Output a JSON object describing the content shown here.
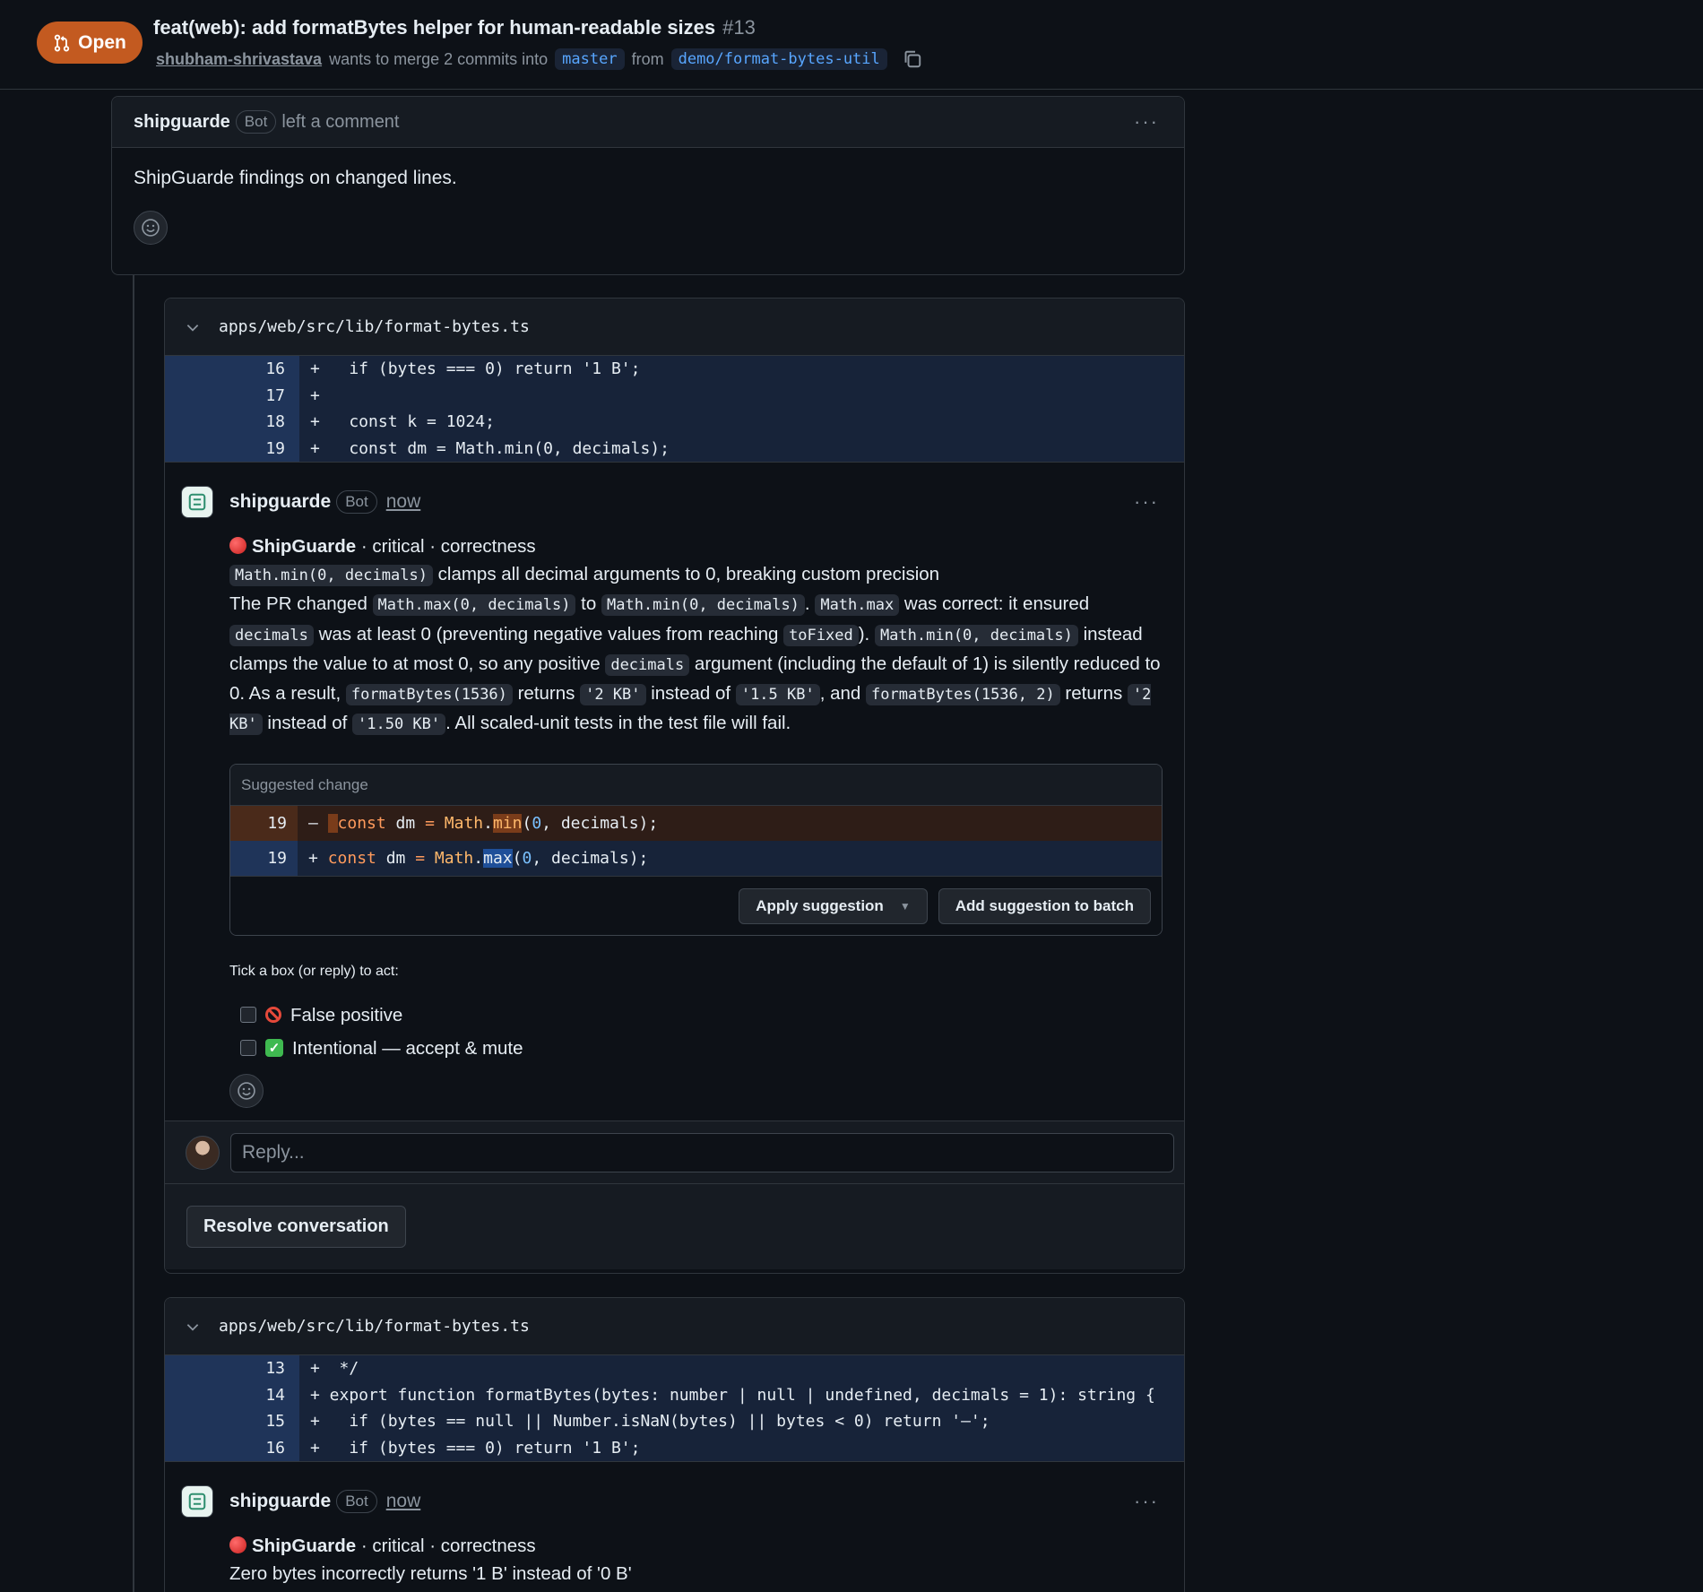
{
  "header": {
    "status": "Open",
    "title": "feat(web): add formatBytes helper for human-readable sizes",
    "number": "#13",
    "author": "shubham-shrivastava",
    "merge_text": "wants to merge 2 commits into",
    "base_branch": "master",
    "from_text": "from",
    "head_branch": "demo/format-bytes-util"
  },
  "top_comment": {
    "author": "shipguarde",
    "badge": "Bot",
    "action": "left a comment",
    "body": "ShipGuarde findings on changed lines."
  },
  "thread1": {
    "file": "apps/web/src/lib/format-bytes.ts",
    "diff": [
      {
        "line": "16",
        "code": "+   if (bytes === 0) return '1 B';"
      },
      {
        "line": "17",
        "code": "+"
      },
      {
        "line": "18",
        "code": "+   const k = 1024;"
      },
      {
        "line": "19",
        "code": "+   const dm = Math.min(0, decimals);"
      }
    ],
    "comment": {
      "author": "shipguarde",
      "badge": "Bot",
      "time": "now",
      "title_brand": "ShipGuarde",
      "title_rest": " · critical · correctness",
      "summary_code": "Math.min(0, decimals)",
      "summary_text": " clamps all decimal arguments to 0, breaking custom precision",
      "p1": "The PR changed ",
      "c1": "Math.max(0, decimals)",
      "p2": " to ",
      "c2": "Math.min(0, decimals)",
      "p3": ". ",
      "c3": "Math.max",
      "p4": " was correct: it ensured ",
      "c4": "decimals",
      "p5": " was at least 0 (preventing negative values from reaching ",
      "c5": "toFixed",
      "p6": "). ",
      "c6": "Math.min(0, decimals)",
      "p7": " instead clamps the value to at most 0, so any positive ",
      "c7": "decimals",
      "p8": " argument (including the default of 1) is silently reduced to 0. As a result, ",
      "c8": "formatBytes(1536)",
      "p9": " returns ",
      "c9": "'2 KB'",
      "p10": " instead of ",
      "c10": "'1.5 KB'",
      "p11": ", and ",
      "c11": "formatBytes(1536, 2)",
      "p12": " returns ",
      "c12": "'2 KB'",
      "p13": " instead of ",
      "c13": "'1.50 KB'",
      "p14": ". All scaled-unit tests in the test file will fail.",
      "suggestion": {
        "label": "Suggested change",
        "del_line": "19",
        "add_line": "19",
        "apply_label": "Apply suggestion",
        "batch_label": "Add suggestion to batch"
      },
      "act_label": "Tick a box (or reply) to act:",
      "option1": "False positive",
      "option2": "Intentional — accept & mute"
    },
    "reply_placeholder": "Reply...",
    "resolve_label": "Resolve conversation"
  },
  "thread2": {
    "file": "apps/web/src/lib/format-bytes.ts",
    "diff": [
      {
        "line": "13",
        "code": "+  */"
      },
      {
        "line": "14",
        "code": "+ export function formatBytes(bytes: number | null | undefined, decimals = 1): string {"
      },
      {
        "line": "15",
        "code": "+   if (bytes == null || Number.isNaN(bytes) || bytes < 0) return '—';"
      },
      {
        "line": "16",
        "code": "+   if (bytes === 0) return '1 B';"
      }
    ],
    "comment": {
      "author": "shipguarde",
      "badge": "Bot",
      "time": "now",
      "title_brand": "ShipGuarde",
      "title_rest": " · critical · correctness",
      "summary": "Zero bytes incorrectly returns '1 B' instead of '0 B'"
    }
  }
}
